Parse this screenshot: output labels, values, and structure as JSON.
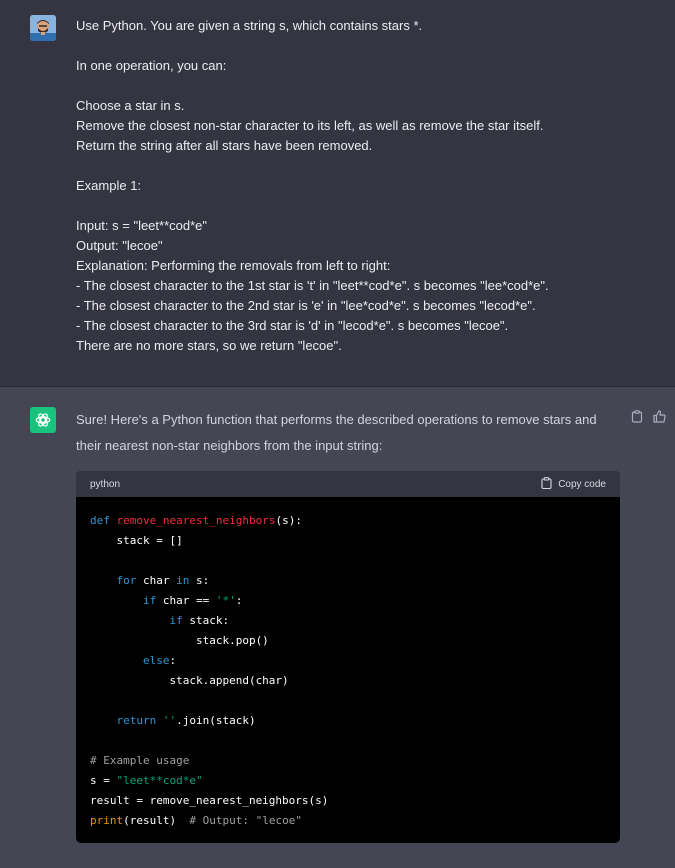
{
  "user_message": {
    "lines": [
      "Use Python. You are given a string s, which contains stars *.",
      "",
      "In one operation, you can:",
      "",
      "Choose a star in s.",
      "Remove the closest non-star character to its left, as well as remove the star itself.",
      "Return the string after all stars have been removed.",
      "",
      "Example 1:",
      "",
      "Input: s = \"leet**cod*e\"",
      "Output: \"lecoe\"",
      "Explanation: Performing the removals from left to right:",
      "- The closest character to the 1st star is 't' in \"leet**cod*e\". s becomes \"lee*cod*e\".",
      "- The closest character to the 2nd star is 'e' in \"lee*cod*e\". s becomes \"lecod*e\".",
      "- The closest character to the 3rd star is 'd' in \"lecod*e\". s becomes \"lecoe\".",
      "There are no more stars, so we return \"lecoe\"."
    ]
  },
  "assistant_message": {
    "text": "Sure! Here's a Python function that performs the described operations to remove stars and their nearest non-star neighbors from the input string:",
    "code_block": {
      "language": "python",
      "copy_label": "Copy code",
      "lines": [
        "def remove_nearest_neighbors(s):",
        "    stack = []",
        "",
        "    for char in s:",
        "        if char == '*':",
        "            if stack:",
        "                stack.pop()",
        "        else:",
        "            stack.append(char)",
        "",
        "    return ''.join(stack)",
        "",
        "# Example usage",
        "s = \"leet**cod*e\"",
        "result = remove_nearest_neighbors(s)",
        "print(result)  # Output: \"lecoe\""
      ]
    }
  },
  "colors": {
    "user_bg": "#343541",
    "assistant_bg": "#444654",
    "gpt_avatar": "#19c37d",
    "code_bg": "#000000",
    "keyword": "#2e95d3",
    "function_name": "#f22c3d",
    "string": "#00a67d",
    "comment": "#a0a0a0"
  },
  "icons": [
    "user-avatar",
    "openai-logo-icon",
    "clipboard-icon",
    "thumbs-up-icon"
  ]
}
